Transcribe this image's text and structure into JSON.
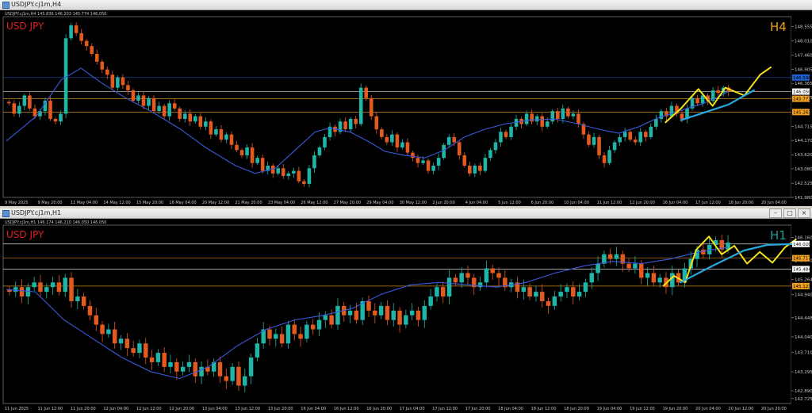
{
  "windows": [
    {
      "title": "USDJPY.cj1m,H4",
      "symbol_label": "USD JPY",
      "timeframe": "H4",
      "info_line": "USDJPY.cj1m,H4  145.836 146.203 145.774 146.050",
      "colors": {
        "bull": "#1fb6a8",
        "bear": "#e35a1e",
        "ma": "#3b59d9",
        "sketch": "#f3e21a",
        "fit": "#29a8e0",
        "symbol": "#e02020",
        "tf": "#f0a020"
      },
      "chart_data": {
        "type": "candlestick",
        "title": "USD JPY",
        "y_ticks": [
          148.555,
          148.01,
          147.46,
          146.905,
          146.365,
          145.815,
          144.715,
          144.17,
          143.62,
          143.08,
          142.525,
          141.98
        ],
        "price_labels": [
          {
            "text": "146.590",
            "value": 146.59,
            "color": "#2060d0"
          },
          {
            "text": "146.050",
            "value": 146.05,
            "color": "#ffffff"
          },
          {
            "text": "145.773",
            "value": 145.773,
            "color": "#f0a020"
          },
          {
            "text": "145.263",
            "value": 145.263,
            "color": "#f0a020"
          }
        ],
        "x_labels": [
          "9 May 2025",
          "9 May 20:00",
          "11 May 04:00",
          "14 May 12:00",
          "15 May 20:00",
          "16 May 04:00",
          "20 May 12:00",
          "21 May 20:00",
          "23 May 04:00",
          "26 May 12:00",
          "27 May 20:00",
          "29 May 04:00",
          "30 May 12:00",
          "2 Jun 20:00",
          "4 Jun 04:00",
          "5 Jun 12:00",
          "6 Jun 20:00",
          "10 Jun 04:00",
          "11 Jun 12:00",
          "12 Jun 20:00",
          "16 Jun 04:00",
          "17 Jun 12:00",
          "18 Jun 20:00",
          "20 Jun 04:00"
        ],
        "ylim": [
          141.98,
          148.75
        ],
        "closes": [
          145.6,
          145.2,
          145.5,
          145.9,
          145.4,
          145.1,
          145.3,
          145.7,
          145.0,
          144.9,
          145.2,
          148.1,
          148.6,
          148.3,
          148.0,
          147.8,
          147.5,
          147.2,
          146.9,
          146.7,
          146.2,
          146.6,
          146.3,
          146.1,
          145.7,
          145.9,
          145.5,
          145.8,
          145.3,
          145.5,
          145.1,
          145.6,
          145.4,
          145.0,
          145.2,
          144.9,
          145.1,
          144.7,
          144.9,
          144.4,
          144.6,
          144.2,
          144.4,
          144.0,
          143.8,
          143.6,
          143.9,
          143.3,
          143.5,
          143.0,
          143.2,
          142.9,
          143.1,
          142.8,
          142.9,
          143.0,
          142.6,
          142.5,
          143.1,
          143.6,
          143.9,
          144.3,
          144.7,
          144.5,
          144.9,
          144.6,
          145.0,
          144.8,
          146.2,
          145.8,
          145.1,
          144.6,
          144.3,
          144.1,
          144.4,
          143.9,
          144.1,
          143.7,
          143.5,
          143.3,
          143.4,
          143.0,
          143.2,
          143.5,
          144.0,
          144.3,
          144.1,
          143.6,
          143.2,
          142.9,
          143.2,
          143.0,
          143.5,
          143.8,
          144.1,
          144.5,
          144.3,
          144.7,
          145.0,
          144.8,
          145.2,
          144.9,
          145.1,
          144.7,
          144.9,
          145.3,
          145.0,
          145.4,
          145.1,
          145.2,
          144.8,
          144.4,
          144.0,
          144.3,
          143.6,
          143.3,
          143.8,
          144.1,
          144.3,
          144.5,
          144.2,
          144.1,
          144.5,
          144.3,
          144.7,
          145.0,
          145.3,
          145.1,
          145.5,
          145.2,
          145.0,
          145.4,
          145.8,
          145.6,
          145.9,
          145.7,
          146.1,
          146.0,
          146.2,
          146.05
        ],
        "ma_points": [
          [
            0,
            144.15
          ],
          [
            12,
            145.1
          ],
          [
            22,
            146.5
          ],
          [
            30,
            146.95
          ],
          [
            38,
            146.4
          ],
          [
            48,
            145.8
          ],
          [
            58,
            145.3
          ],
          [
            70,
            144.6
          ],
          [
            80,
            143.9
          ],
          [
            92,
            143.2
          ],
          [
            100,
            142.9
          ],
          [
            108,
            143.1
          ],
          [
            116,
            143.8
          ],
          [
            124,
            144.5
          ],
          [
            130,
            144.65
          ],
          [
            138,
            144.5
          ],
          [
            146,
            144.1
          ],
          [
            152,
            143.75
          ],
          [
            160,
            143.6
          ],
          [
            168,
            143.5
          ],
          [
            176,
            143.8
          ],
          [
            184,
            144.3
          ],
          [
            192,
            144.6
          ],
          [
            200,
            144.8
          ],
          [
            210,
            144.95
          ],
          [
            220,
            145.0
          ],
          [
            230,
            144.8
          ],
          [
            238,
            144.6
          ],
          [
            246,
            144.45
          ],
          [
            254,
            144.7
          ],
          [
            262,
            145.05
          ],
          [
            270,
            145.3
          ],
          [
            280,
            145.6
          ],
          [
            286,
            145.85
          ],
          [
            290,
            146.05
          ]
        ]
      }
    },
    {
      "title": "USDJPY.cj1m,H1",
      "symbol_label": "USD JPY",
      "timeframe": "H1",
      "info_line": "USDJPY.cj1m,H1  146.174 146.210 146.050 146.050",
      "colors": {
        "bull": "#1fb6a8",
        "bear": "#e35a1e",
        "ma": "#3b59d9",
        "sketch": "#f3e21a",
        "fit": "#29a8e0",
        "symbol": "#e02020",
        "tf": "#1e9a9a"
      },
      "chart_data": {
        "type": "candlestick",
        "title": "USD JPY",
        "y_ticks": [
          146.16,
          145.67,
          145.264,
          144.94,
          144.448,
          144.04,
          143.71,
          143.295,
          142.89,
          142.725
        ],
        "price_labels": [
          {
            "text": "146.020",
            "value": 146.02,
            "color": "#ffffff"
          },
          {
            "text": "145.717",
            "value": 145.717,
            "color": "#f0a020"
          },
          {
            "text": "145.484",
            "value": 145.484,
            "color": "#ffffff"
          },
          {
            "text": "145.123",
            "value": 145.123,
            "color": "#f0a020"
          }
        ],
        "x_labels": [
          "11 Jun 2025",
          "11 Jun 12:00",
          "11 Jun 20:00",
          "12 Jun 04:00",
          "12 Jun 12:00",
          "12 Jun 20:00",
          "13 Jun 04:00",
          "13 Jun 12:00",
          "13 Jun 20:00",
          "16 Jun 04:00",
          "16 Jun 12:00",
          "16 Jun 20:00",
          "17 Jun 04:00",
          "17 Jun 12:00",
          "17 Jun 20:00",
          "18 Jun 04:00",
          "18 Jun 12:00",
          "18 Jun 20:00",
          "19 Jun 04:00",
          "19 Jun 12:00",
          "19 Jun 20:00",
          "20 Jun 04:00",
          "20 Jun 12:00",
          "20 Jun 20:00"
        ],
        "ylim": [
          142.62,
          146.32
        ],
        "closes": [
          145.0,
          145.1,
          144.9,
          145.1,
          145.2,
          145.0,
          145.1,
          145.2,
          145.0,
          145.3,
          144.8,
          144.9,
          144.7,
          144.5,
          144.3,
          144.1,
          144.2,
          143.9,
          144.0,
          143.8,
          143.7,
          143.9,
          143.6,
          143.5,
          143.7,
          143.4,
          143.5,
          143.3,
          143.4,
          143.5,
          143.2,
          143.4,
          143.3,
          143.5,
          143.2,
          143.1,
          143.4,
          143.0,
          143.2,
          143.6,
          143.9,
          144.2,
          144.0,
          144.1,
          143.9,
          144.3,
          144.1,
          144.0,
          144.3,
          144.2,
          144.4,
          144.5,
          144.3,
          144.7,
          144.5,
          144.6,
          144.4,
          144.8,
          144.6,
          144.5,
          144.7,
          144.4,
          144.6,
          144.3,
          144.5,
          144.6,
          144.4,
          144.7,
          144.9,
          145.1,
          144.9,
          145.3,
          145.2,
          145.4,
          145.3,
          145.1,
          145.2,
          145.5,
          145.4,
          145.3,
          145.1,
          145.2,
          145.0,
          145.1,
          144.9,
          145.0,
          144.8,
          144.7,
          144.9,
          145.0,
          145.1,
          144.9,
          145.0,
          145.2,
          145.4,
          145.6,
          145.8,
          145.7,
          145.8,
          145.6,
          145.5,
          145.6,
          145.3,
          145.4,
          145.2,
          145.3,
          145.1,
          145.4,
          145.2,
          145.5,
          145.7,
          145.9,
          145.8,
          146.0,
          146.1,
          145.9,
          146.05
        ],
        "ma_points": [
          [
            0,
            145.05
          ],
          [
            20,
            145.0
          ],
          [
            40,
            144.4
          ],
          [
            60,
            144.0
          ],
          [
            80,
            143.6
          ],
          [
            100,
            143.3
          ],
          [
            120,
            143.15
          ],
          [
            140,
            143.4
          ],
          [
            160,
            143.85
          ],
          [
            180,
            144.2
          ],
          [
            200,
            144.4
          ],
          [
            220,
            144.5
          ],
          [
            240,
            144.65
          ],
          [
            260,
            144.95
          ],
          [
            280,
            145.15
          ],
          [
            300,
            145.2
          ],
          [
            320,
            145.15
          ],
          [
            340,
            145.1
          ],
          [
            360,
            145.2
          ],
          [
            380,
            145.4
          ],
          [
            400,
            145.55
          ],
          [
            420,
            145.65
          ],
          [
            440,
            145.6
          ],
          [
            460,
            145.7
          ],
          [
            480,
            145.85
          ],
          [
            500,
            145.95
          ]
        ]
      }
    }
  ]
}
